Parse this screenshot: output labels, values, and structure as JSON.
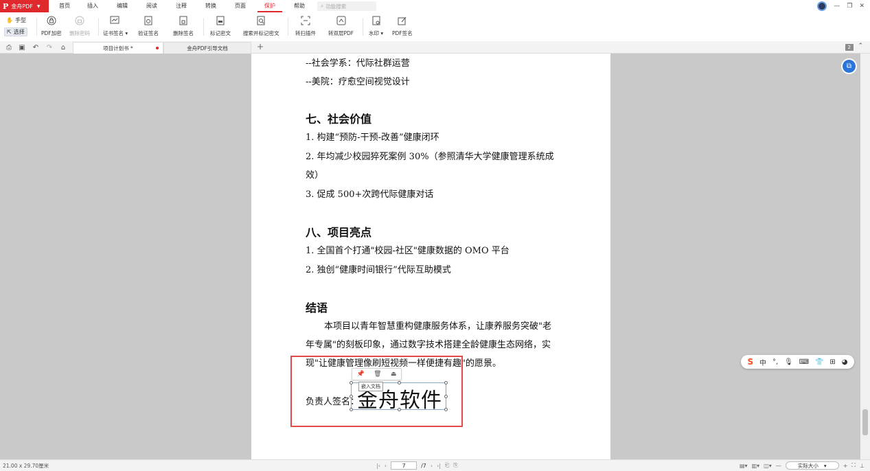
{
  "app": {
    "name": "金舟PDF",
    "logo": "P"
  },
  "menu": {
    "items": [
      "首页",
      "插入",
      "编辑",
      "阅读",
      "注释",
      "转换",
      "页面",
      "保护",
      "帮助"
    ],
    "active": "保护",
    "search_placeholder": "功能搜索"
  },
  "ribbon": {
    "tool_hand": "手型",
    "tool_select": "选择",
    "buttons": {
      "pdf_encrypt": "PDF加密",
      "remove_password": "删除密码",
      "cert_sign": "证书签名 ▾",
      "verify_sign": "验证签名",
      "delete_sign": "删除签名",
      "mark_redact": "标记密文",
      "search_mark_redact": "搜索并标记密文",
      "scan_plugin": "转扫插件",
      "double_layer": "转双层PDF",
      "watermark": "水印 ▾",
      "pdf_sign": "PDF签名"
    }
  },
  "tabs": {
    "tab1": "项目计划书 *",
    "tab2": "金舟PDF引导文档",
    "page_badge": "2"
  },
  "document": {
    "lines": {
      "l1": "--社会学系：代际社群运营",
      "l2": "--美院：疗愈空间视觉设计",
      "h7": "七、社会价值",
      "s1": "1. 构建“预防-干预-改善”健康闭环",
      "s2a": "2. 年均减少校园猝死案例 30%（参照清华大学健康管理系统成",
      "s2b": "效）",
      "s3": "3.  促成 500+次跨代际健康对话",
      "h8": "八、项目亮点",
      "p1": "1. 全国首个打通\"校园-社区\"健康数据的 OMO 平台",
      "p2": "2. 独创“健康时间银行”代际互助模式",
      "hc": "结语",
      "c1": "本项目以青年智慧重构健康服务体系，让康养服务突破\"老",
      "c2": "年专属\"的刻板印象，通过数字技术搭建全龄健康生态网络，实",
      "c3": "现\"让健康管理像刷短视频一样便捷有趣\"的愿景。",
      "signer_label": "负责人签名："
    },
    "signature_text": "金舟软件",
    "embed_tooltip": "嵌入文档"
  },
  "statusbar": {
    "page_size": "21.00 x 29.70厘米",
    "current_page": "7",
    "total_pages": "/7",
    "zoom": "实际大小"
  },
  "ime": {
    "mode": "中"
  },
  "colors": {
    "brand": "#e0292c",
    "selection": "#e24a4a",
    "float_tool": "#2d74d8"
  }
}
